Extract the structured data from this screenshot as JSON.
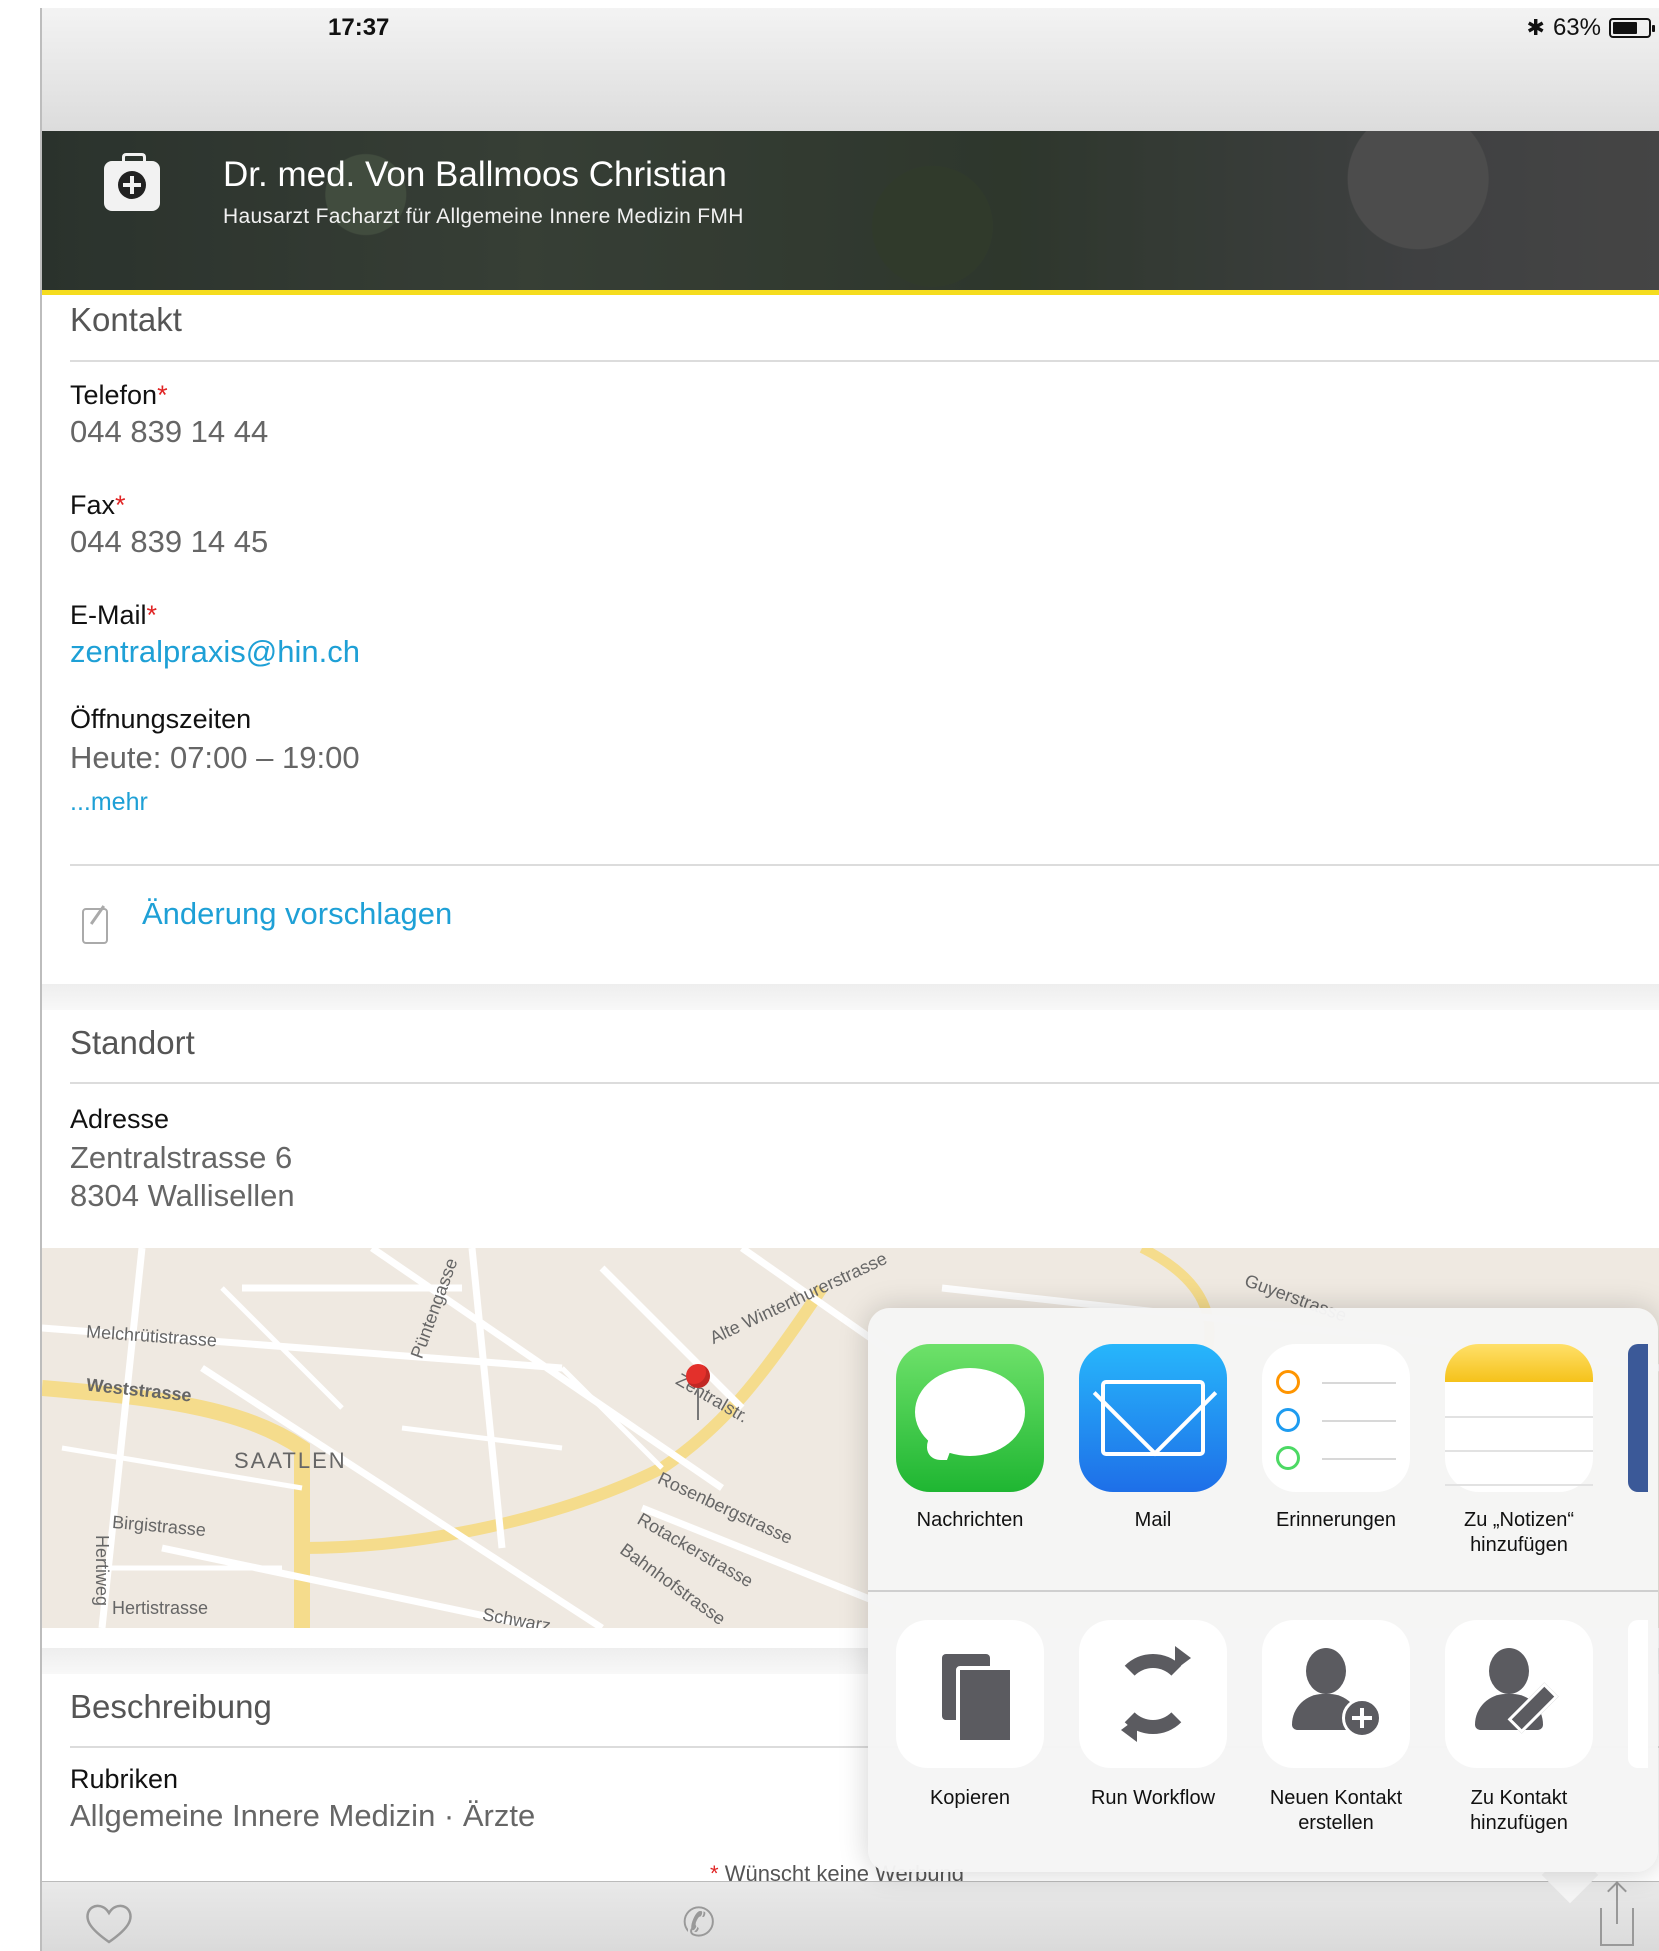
{
  "status": {
    "time": "17:37",
    "bluetooth": "✱",
    "battery": "63%"
  },
  "header": {
    "title": "Dr. med. Von Ballmoos Christian",
    "subtitle": "Hausarzt Facharzt für Allgemeine Innere Medizin FMH"
  },
  "kontakt": {
    "section_title": "Kontakt",
    "telefon_label": "Telefon",
    "telefon_value": "044 839 14 44",
    "fax_label": "Fax",
    "fax_value": "044 839 14 45",
    "email_label": "E-Mail",
    "email_value": "zentralpraxis@hin.ch",
    "hours_label": "Öffnungszeiten",
    "hours_value": "Heute: 07:00 – 19:00",
    "more": "...mehr",
    "required_mark": "*"
  },
  "suggest": {
    "label": "Änderung vorschlagen"
  },
  "standort": {
    "section_title": "Standort",
    "address_label": "Adresse",
    "address_line1": "Zentralstrasse 6",
    "address_line2": "8304 Wallisellen"
  },
  "map": {
    "labels": [
      "Melchrütistrasse",
      "Weststrasse",
      "SAATLEN",
      "Birgistrasse",
      "Hertistrasse",
      "Hertiweg",
      "Püntengasse",
      "Rosenbergstrasse",
      "Rotackerstrasse",
      "Bahnhofstrasse",
      "Schwarz",
      "Guyerstrasse",
      "Alte Winterthurerstrasse",
      "Zentralstr."
    ]
  },
  "beschreibung": {
    "section_title": "Beschreibung",
    "rubriken_label": "Rubriken",
    "rubriken_value": "Allgemeine Innere Medizin · Ärzte"
  },
  "footnote": {
    "mark": "*",
    "text": "Wünscht keine Werbung"
  },
  "share_sheet": {
    "apps": [
      {
        "label": "Nachrichten",
        "icon": "messages-icon"
      },
      {
        "label": "Mail",
        "icon": "mail-icon"
      },
      {
        "label": "Erinnerungen",
        "icon": "reminders-icon"
      },
      {
        "label": "Zu „Notizen“ hinzufügen",
        "icon": "notes-icon"
      }
    ],
    "actions": [
      {
        "label": "Kopieren",
        "icon": "copy-icon"
      },
      {
        "label": "Run Workflow",
        "icon": "workflow-icon"
      },
      {
        "label": "Neuen Kontakt erstellen",
        "icon": "new-contact-icon"
      },
      {
        "label": "Zu Kontakt hinzufügen",
        "icon": "add-to-contact-icon"
      }
    ]
  },
  "colors": {
    "accent": "#1ea0d6",
    "required": "#e02424",
    "header_border": "#f5dc1e",
    "messages": "#34c84a",
    "mail": "#1f8ef1"
  }
}
